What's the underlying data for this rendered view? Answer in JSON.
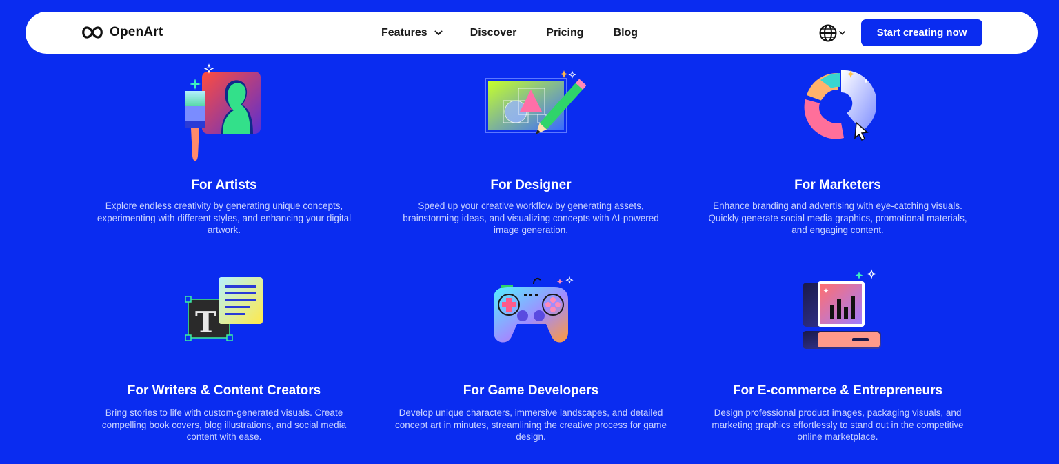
{
  "header": {
    "brand": "OpenArt",
    "nav": [
      {
        "label": "Features"
      },
      {
        "label": "Discover"
      },
      {
        "label": "Pricing"
      },
      {
        "label": "Blog"
      }
    ],
    "cta_label": "Start creating now"
  },
  "cards": [
    {
      "title": "For Artists",
      "description": "Explore endless creativity by generating unique concepts, experimenting with different styles, and enhancing your digital artwork."
    },
    {
      "title": "For Designer",
      "description": "Speed up your creative workflow by generating assets, brainstorming ideas, and visualizing concepts with AI-powered image generation."
    },
    {
      "title": "For Marketers",
      "description": "Enhance branding and advertising with eye-catching visuals. Quickly generate social media graphics, promotional materials, and engaging content."
    },
    {
      "title": "For Writers & Content Creators",
      "description": "Bring stories to life with custom-generated visuals. Create compelling book covers, blog illustrations, and social media content with ease."
    },
    {
      "title": "For Game Developers",
      "description": "Develop unique characters, immersive landscapes, and detailed concept art in minutes, streamlining the creative process for game design."
    },
    {
      "title": "For E-commerce & Entrepreneurs",
      "description": "Design professional product images, packaging visuals, and marketing graphics effortlessly to stand out in the competitive online marketplace."
    }
  ],
  "icons": {
    "logo": "infinity-logo-icon",
    "features_chevron": "chevron-down-icon",
    "language": "globe-icon",
    "language_chevron": "chevron-down-icon",
    "artists": "paintbrush-portrait-icon",
    "designer": "design-canvas-pencil-icon",
    "marketers": "donut-chart-cursor-icon",
    "writers": "text-document-icon",
    "game": "gamepad-icon",
    "ecommerce": "computer-bar-chart-icon"
  },
  "colors": {
    "page_background": "#0a2cf0",
    "nav_background": "#ffffff",
    "cta_background": "#0a2cf0",
    "description_text": "#c9d2ff"
  }
}
